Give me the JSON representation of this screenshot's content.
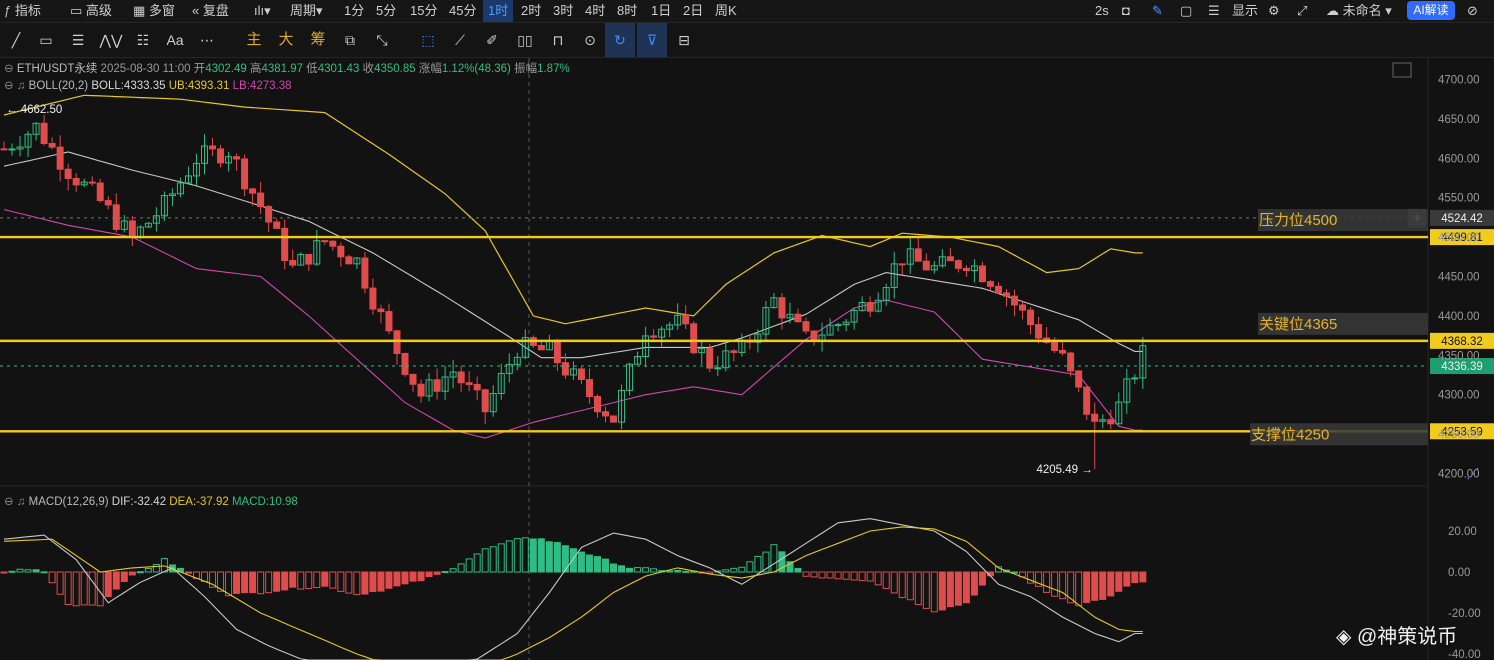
{
  "topbar": {
    "items": [
      "指标",
      "高级",
      "多窗",
      "复盘",
      "周期",
      "1分",
      "5分",
      "15分",
      "45分",
      "1时",
      "2时",
      "3时",
      "4时",
      "8时",
      "1日",
      "2日",
      "周K"
    ],
    "active": "1时",
    "refresh": "2s",
    "display": "显示",
    "workspace": "未命名",
    "ai": "AI解读"
  },
  "toolbar": {
    "text_tools": [
      "Aa",
      "主",
      "大",
      "筹"
    ]
  },
  "header": {
    "pair": "ETH/USDT永续",
    "datetime": "2025-08-30 11:00",
    "open_label": "开",
    "open": "4302.49",
    "high_label": "高",
    "high": "4381.97",
    "low_label": "低",
    "low": "4301.43",
    "close_label": "收",
    "close": "4350.85",
    "change_label": "涨幅",
    "change": "1.12%(48.36)",
    "amp_label": "振幅",
    "amp": "1.87%"
  },
  "boll": {
    "name": "BOLL(20,2)",
    "mid": "BOLL:4333.35",
    "ub": "UB:4393.31",
    "lb": "LB:4273.38"
  },
  "macd": {
    "name": "MACD(12,26,9)",
    "dif": "DIF:-32.42",
    "dea": "DEA:-37.92",
    "macd": "MACD:10.98"
  },
  "colors": {
    "up": "#2ebd85",
    "down": "#e04c4c",
    "ub": "#e8c81b",
    "mid": "#c8c8c8",
    "lb": "#d147b0",
    "level": "#f2cc1d"
  },
  "chart_data": {
    "type": "candlestick",
    "price_axis": {
      "range": [
        4200,
        4700
      ],
      "ticks": [
        4200,
        4250,
        4300,
        4350,
        4400,
        4450,
        4500,
        4550,
        4600,
        4650,
        4700
      ]
    },
    "macd_axis": {
      "range": [
        -40,
        20
      ],
      "ticks": [
        20,
        0,
        -20,
        -40
      ],
      "tick_labels": [
        "20.00",
        "0.00",
        "-20.00",
        "-40.00"
      ]
    },
    "levels": [
      {
        "label": "压力位4500",
        "value": 4500,
        "tag": "4499.81"
      },
      {
        "label": "关键位4365",
        "value": 4368.32,
        "tag": "4368.32"
      },
      {
        "label": "支撑位4250",
        "value": 4253.59,
        "tag": "4253.59"
      }
    ],
    "dashed_lines": [
      {
        "value": 4524.42,
        "tag": "4524.42"
      },
      {
        "value": 4336.39,
        "tag": "4336.39"
      }
    ],
    "annotations": [
      {
        "text": "← 4662.50",
        "value": 4662.5,
        "bar": 0
      },
      {
        "text": "4205.49 →",
        "value": 4205.49,
        "bar": 136
      }
    ],
    "candle_count": 143,
    "close_path": [
      [
        0,
        4612
      ],
      [
        4,
        4640
      ],
      [
        8,
        4585
      ],
      [
        12,
        4545
      ],
      [
        16,
        4498
      ],
      [
        20,
        4540
      ],
      [
        24,
        4600
      ],
      [
        28,
        4610
      ],
      [
        32,
        4540
      ],
      [
        36,
        4460
      ],
      [
        40,
        4495
      ],
      [
        44,
        4470
      ],
      [
        48,
        4375
      ],
      [
        52,
        4300
      ],
      [
        56,
        4330
      ],
      [
        60,
        4280
      ],
      [
        64,
        4360
      ],
      [
        68,
        4355
      ],
      [
        72,
        4310
      ],
      [
        76,
        4270
      ],
      [
        80,
        4385
      ],
      [
        84,
        4390
      ],
      [
        88,
        4340
      ],
      [
        92,
        4355
      ],
      [
        96,
        4420
      ],
      [
        100,
        4370
      ],
      [
        104,
        4390
      ],
      [
        108,
        4420
      ],
      [
        112,
        4475
      ],
      [
        116,
        4460
      ],
      [
        120,
        4470
      ],
      [
        124,
        4440
      ],
      [
        128,
        4390
      ],
      [
        132,
        4345
      ],
      [
        136,
        4260
      ],
      [
        139,
        4285
      ],
      [
        142,
        4350.85
      ]
    ],
    "ub_path": [
      [
        0,
        4655
      ],
      [
        10,
        4680
      ],
      [
        22,
        4675
      ],
      [
        30,
        4665
      ],
      [
        40,
        4658
      ],
      [
        48,
        4605
      ],
      [
        55,
        4555
      ],
      [
        60,
        4508
      ],
      [
        66,
        4400
      ],
      [
        70,
        4390
      ],
      [
        75,
        4400
      ],
      [
        80,
        4410
      ],
      [
        86,
        4400
      ],
      [
        90,
        4440
      ],
      [
        96,
        4480
      ],
      [
        102,
        4502
      ],
      [
        108,
        4488
      ],
      [
        112,
        4505
      ],
      [
        118,
        4500
      ],
      [
        124,
        4488
      ],
      [
        130,
        4455
      ],
      [
        134,
        4460
      ],
      [
        138,
        4485
      ],
      [
        141,
        4480
      ]
    ],
    "mid_path": [
      [
        0,
        4590
      ],
      [
        8,
        4608
      ],
      [
        16,
        4585
      ],
      [
        24,
        4565
      ],
      [
        30,
        4546
      ],
      [
        38,
        4520
      ],
      [
        46,
        4480
      ],
      [
        55,
        4425
      ],
      [
        62,
        4380
      ],
      [
        67,
        4347
      ],
      [
        72,
        4347
      ],
      [
        80,
        4360
      ],
      [
        88,
        4360
      ],
      [
        92,
        4372
      ],
      [
        100,
        4402
      ],
      [
        106,
        4440
      ],
      [
        110,
        4455
      ],
      [
        116,
        4445
      ],
      [
        122,
        4435
      ],
      [
        128,
        4415
      ],
      [
        134,
        4395
      ],
      [
        139,
        4365
      ],
      [
        141,
        4355
      ]
    ],
    "lb_path": [
      [
        0,
        4535
      ],
      [
        8,
        4515
      ],
      [
        16,
        4500
      ],
      [
        24,
        4460
      ],
      [
        32,
        4450
      ],
      [
        38,
        4400
      ],
      [
        44,
        4345
      ],
      [
        50,
        4290
      ],
      [
        56,
        4255
      ],
      [
        60,
        4245
      ],
      [
        66,
        4265
      ],
      [
        72,
        4280
      ],
      [
        80,
        4300
      ],
      [
        86,
        4310
      ],
      [
        92,
        4300
      ],
      [
        100,
        4370
      ],
      [
        106,
        4410
      ],
      [
        110,
        4420
      ],
      [
        116,
        4405
      ],
      [
        122,
        4345
      ],
      [
        128,
        4335
      ],
      [
        134,
        4325
      ],
      [
        139,
        4260
      ],
      [
        141,
        4255
      ]
    ],
    "macd_hist_path": [
      [
        0,
        0
      ],
      [
        3,
        1.5
      ],
      [
        5,
        0
      ],
      [
        8,
        -16
      ],
      [
        12,
        -16
      ],
      [
        15,
        -4
      ],
      [
        18,
        2
      ],
      [
        20,
        6
      ],
      [
        24,
        -3
      ],
      [
        28,
        -11
      ],
      [
        32,
        -10
      ],
      [
        36,
        -8
      ],
      [
        40,
        -7
      ],
      [
        44,
        -11
      ],
      [
        48,
        -8
      ],
      [
        52,
        -4
      ],
      [
        55,
        0
      ],
      [
        60,
        11
      ],
      [
        65,
        17
      ],
      [
        67,
        16
      ],
      [
        70,
        13
      ],
      [
        74,
        7
      ],
      [
        78,
        2
      ],
      [
        82,
        1
      ],
      [
        88,
        -0.5
      ],
      [
        92,
        2
      ],
      [
        96,
        13
      ],
      [
        100,
        -2
      ],
      [
        104,
        -3
      ],
      [
        108,
        -4
      ],
      [
        112,
        -12
      ],
      [
        116,
        -19
      ],
      [
        120,
        -15
      ],
      [
        124,
        2
      ],
      [
        126,
        0
      ],
      [
        130,
        -10
      ],
      [
        134,
        -16
      ],
      [
        138,
        -12
      ],
      [
        141,
        -5
      ]
    ],
    "dif_path": [
      [
        0,
        16
      ],
      [
        5,
        18
      ],
      [
        9,
        6
      ],
      [
        13,
        -15
      ],
      [
        17,
        -5
      ],
      [
        21,
        2
      ],
      [
        25,
        -12
      ],
      [
        29,
        -28
      ],
      [
        33,
        -36
      ],
      [
        38,
        -44
      ],
      [
        42,
        -50
      ],
      [
        48,
        -55
      ],
      [
        52,
        -52
      ],
      [
        56,
        -50
      ],
      [
        60,
        -40
      ],
      [
        64,
        -30
      ],
      [
        68,
        -10
      ],
      [
        72,
        12
      ],
      [
        76,
        19
      ],
      [
        80,
        16
      ],
      [
        84,
        8
      ],
      [
        88,
        2
      ],
      [
        92,
        -6
      ],
      [
        96,
        4
      ],
      [
        100,
        14
      ],
      [
        104,
        24
      ],
      [
        108,
        26
      ],
      [
        112,
        23
      ],
      [
        116,
        20
      ],
      [
        120,
        10
      ],
      [
        124,
        -6
      ],
      [
        128,
        -12
      ],
      [
        132,
        -22
      ],
      [
        136,
        -30
      ],
      [
        139,
        -34
      ],
      [
        141,
        -30
      ]
    ],
    "dea_path": [
      [
        0,
        15
      ],
      [
        6,
        16
      ],
      [
        12,
        0
      ],
      [
        16,
        2
      ],
      [
        20,
        3
      ],
      [
        26,
        -6
      ],
      [
        32,
        -20
      ],
      [
        38,
        -30
      ],
      [
        44,
        -40
      ],
      [
        50,
        -48
      ],
      [
        54,
        -50
      ],
      [
        60,
        -46
      ],
      [
        64,
        -40
      ],
      [
        68,
        -32
      ],
      [
        72,
        -22
      ],
      [
        76,
        -10
      ],
      [
        80,
        -2
      ],
      [
        84,
        2
      ],
      [
        88,
        -1
      ],
      [
        92,
        -3
      ],
      [
        96,
        0
      ],
      [
        100,
        8
      ],
      [
        104,
        14
      ],
      [
        108,
        20
      ],
      [
        112,
        22
      ],
      [
        116,
        21
      ],
      [
        120,
        15
      ],
      [
        124,
        2
      ],
      [
        128,
        -4
      ],
      [
        132,
        -10
      ],
      [
        136,
        -22
      ],
      [
        139,
        -28
      ],
      [
        141,
        -29
      ]
    ]
  }
}
